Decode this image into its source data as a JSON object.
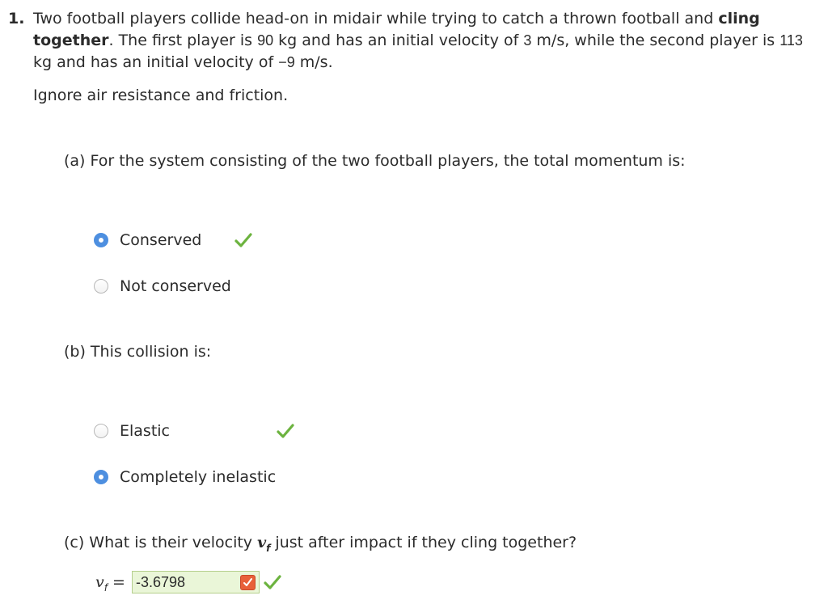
{
  "question": {
    "number": "1.",
    "text_1": "Two football players collide head-on in midair while trying to catch a thrown football and ",
    "emphasis": "cling together",
    "text_2": ". The first player is ",
    "mass1": "90",
    "text_3": " kg and has an initial velocity of ",
    "velocity1": "3",
    "text_4": " m/s, while the second player is ",
    "mass2": "113",
    "text_5": " kg and has an initial velocity of ",
    "velocity2": "−9",
    "text_6": " m/s.",
    "note": "Ignore air resistance and friction."
  },
  "part_a": {
    "prompt": "(a) For the system consisting of the two football players, the total momentum is:",
    "options": [
      {
        "label": "Conserved",
        "selected": true,
        "correct": true
      },
      {
        "label": "Not conserved",
        "selected": false,
        "correct": false
      }
    ]
  },
  "part_b": {
    "prompt": "(b) This collision is:",
    "options": [
      {
        "label": "Elastic",
        "selected": false,
        "correct": true
      },
      {
        "label": "Completely inelastic",
        "selected": true,
        "correct": false
      }
    ]
  },
  "part_c": {
    "prompt_1": "(c) What is their velocity ",
    "prompt_var": "v",
    "prompt_sub": "f",
    "prompt_2": " just after impact if they cling together?",
    "input_label_var": "v",
    "input_label_sub": "f",
    "input_label_eq": " =",
    "answer_value": "-3.6798",
    "answer_correct": true
  },
  "colors": {
    "radio_selected": "#4d8fe0",
    "check_green": "#6cb33f",
    "answer_bg": "#eaf6d8",
    "flag_orange": "#e8603a"
  },
  "icons": {
    "check": "checkmark-icon",
    "flag": "answer-flag-icon"
  }
}
